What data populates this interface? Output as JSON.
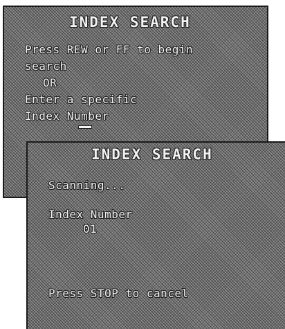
{
  "screen_a": {
    "title": "INDEX SEARCH",
    "line1": "Press REW or FF to begin",
    "line2": "search",
    "line3": "OR",
    "line4": "Enter a specific",
    "line5": "Index Number"
  },
  "screen_b": {
    "title": "INDEX SEARCH",
    "status": "Scanning...",
    "index_label": "Index Number",
    "index_value": "01",
    "cancel_hint": "Press STOP to cancel"
  }
}
